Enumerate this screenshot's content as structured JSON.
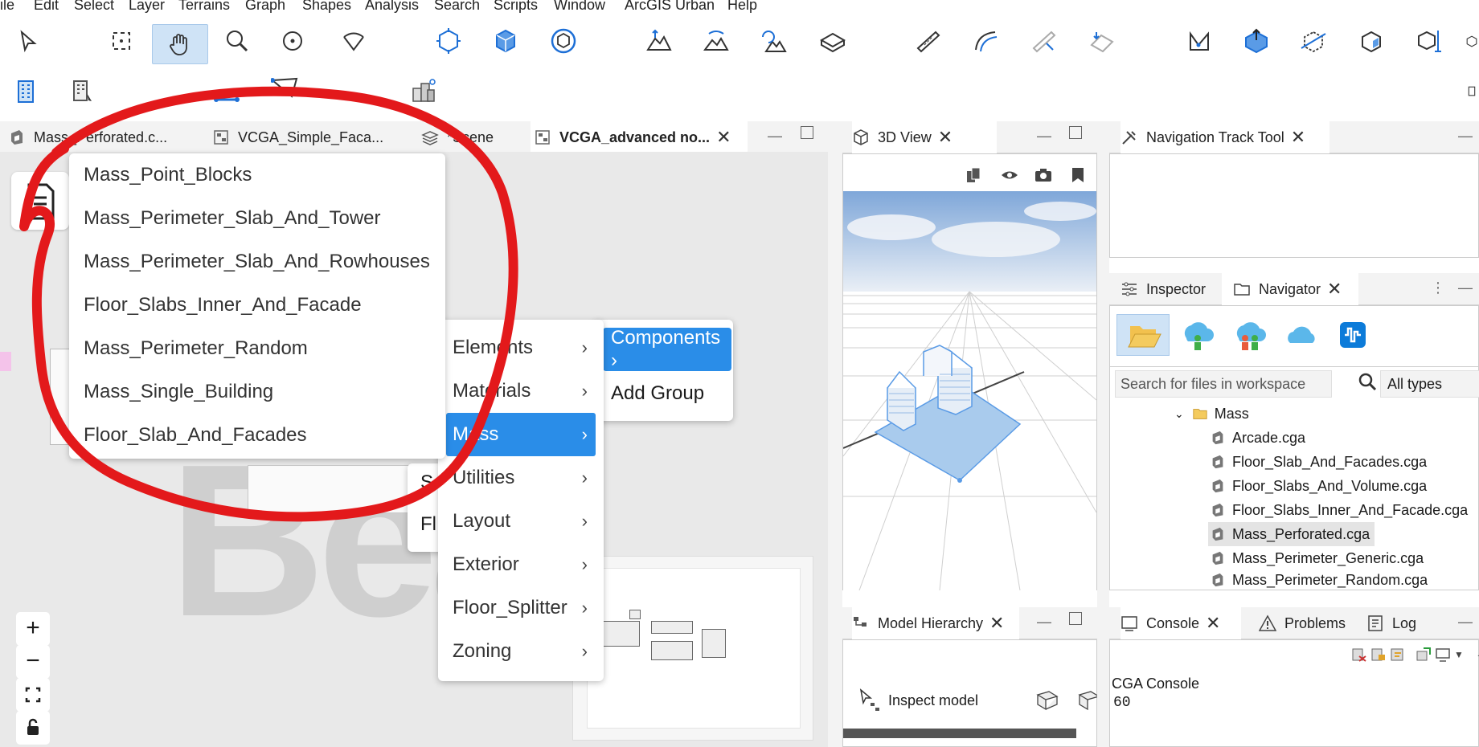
{
  "menubar": {
    "items": [
      "ile",
      "Edit",
      "Select",
      "Layer",
      "Terrains",
      "Graph",
      "Shapes",
      "Analysis",
      "Search",
      "Scripts",
      "Window",
      "ArcGIS Urban",
      "Help"
    ]
  },
  "editor_tabs": [
    {
      "label": "Mass_Perforated.c..."
    },
    {
      "label": "VCGA_Simple_Faca..."
    },
    {
      "label": "*Scene"
    },
    {
      "label": "VCGA_advanced no..."
    }
  ],
  "mass_menu": {
    "items": [
      "Mass_Point_Blocks",
      "Mass_Perimeter_Slab_And_Tower",
      "Mass_Perimeter_Slab_And_Rowhouses",
      "Floor_Slabs_Inner_And_Facade",
      "Mass_Perimeter_Random",
      "Mass_Single_Building",
      "Floor_Slab_And_Facades"
    ]
  },
  "category_menu": {
    "items": [
      {
        "label": "Elements"
      },
      {
        "label": "Materials"
      },
      {
        "label": "Mass"
      },
      {
        "label": "Utilities"
      },
      {
        "label": "Layout"
      },
      {
        "label": "Exterior"
      },
      {
        "label": "Floor_Splitter"
      },
      {
        "label": "Zoning"
      }
    ],
    "chevron": "›",
    "selected": "Mass"
  },
  "root_menu": {
    "components_label": "Components ›",
    "add_group_label": "Add Group"
  },
  "behind_menu": {
    "s_label": "S",
    "fl_label": "Fl"
  },
  "view3d": {
    "tab_label": "3D View"
  },
  "model_hierarchy": {
    "tab_label": "Model Hierarchy",
    "inspect_label": "Inspect model"
  },
  "nav_track": {
    "tab_label": "Navigation Track Tool"
  },
  "inspector_tab": {
    "label": "Inspector"
  },
  "navigator": {
    "tab_label": "Navigator",
    "search_placeholder": "Search for files in workspace",
    "filter_label": "All types",
    "folder": "Mass",
    "files": [
      "Arcade.cga",
      "Floor_Slab_And_Facades.cga",
      "Floor_Slabs_And_Volume.cga",
      "Floor_Slabs_Inner_And_Facade.cga",
      "Mass_Perforated.cga",
      "Mass_Perimeter_Generic.cga",
      "Mass_Perimeter_Random.cga"
    ],
    "selected_file": "Mass_Perforated.cga"
  },
  "console": {
    "tabs": [
      {
        "label": "Console"
      },
      {
        "label": "Problems"
      },
      {
        "label": "Log"
      }
    ],
    "title": "CGA Console",
    "output": "60"
  },
  "zoom_controls": {
    "plus": "+",
    "minus": "−"
  },
  "colors": {
    "accent": "#2196f3",
    "selected_menu": "#2a8de8",
    "annotation": "#e3191b"
  }
}
